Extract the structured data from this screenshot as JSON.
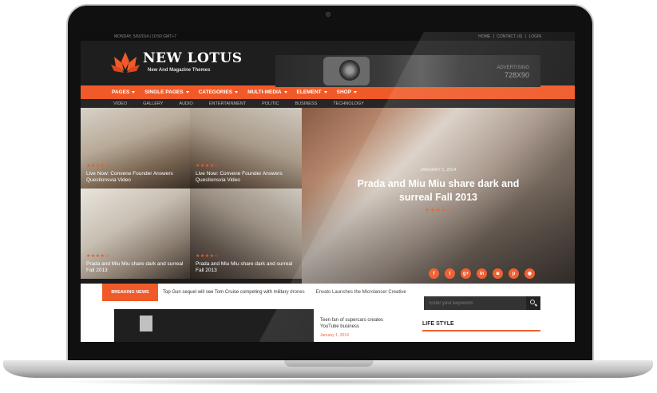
{
  "topbar": {
    "date": "MONDAY, 5/6/2014 | 10:50 GMT+7",
    "links": [
      "HOME",
      "|",
      "CONTACT US",
      "|",
      "LOGIN"
    ]
  },
  "header": {
    "logo_title": "NEW LOTUS",
    "logo_subtitle": "New And Magazine Themes",
    "ad_label": "ADVERTISING",
    "ad_size": "728X90"
  },
  "nav": {
    "items": [
      "PAGES",
      "SINGLE PAGES",
      "CATEGORIES",
      "MULTI-MEDIA",
      "ELEMENT",
      "SHOP"
    ]
  },
  "subnav": {
    "items": [
      "VIDEO",
      "GALLERY",
      "AUDIO",
      "ENTERTAINMENT",
      "POLITIC",
      "BUSINESS",
      "TECHNOLOGY"
    ]
  },
  "featured": {
    "tiles": [
      {
        "title": "Live Now: Convene Founder Answers Questionsvia Video",
        "rating": 4
      },
      {
        "title": "Live Now: Convene Founder Answers Questionsvia Video",
        "rating": 4
      },
      {
        "title": "Prada and Miu Miu share dark and surreal Fall 2013",
        "rating": 4
      },
      {
        "title": "Prada and Miu Miu share dark and surreal Fall 2013",
        "rating": 4
      }
    ],
    "main": {
      "date": "JANUARY 1, 2014",
      "title": "Prada and Miu Miu share dark and surreal Fall 2013",
      "rating": 4
    },
    "stars_text": "★★★★☆"
  },
  "social": [
    "f",
    "t",
    "g+",
    "in",
    "◙",
    "p",
    "◉"
  ],
  "breaking": {
    "label": "BREAKING NEWS",
    "items": [
      "Top Gun sequel will see Tom Cruise competing with military drones",
      "Envato Launches the Microlancer Creative"
    ]
  },
  "sidebar": {
    "search_placeholder": "Enter your keywords",
    "section_title": "LIFE STYLE"
  },
  "post": {
    "title": "Teen fan of supercars creates YouTube business",
    "date": "January 1, 2014"
  },
  "colors": {
    "accent": "#f05a28",
    "dark": "#1e1e1e"
  }
}
